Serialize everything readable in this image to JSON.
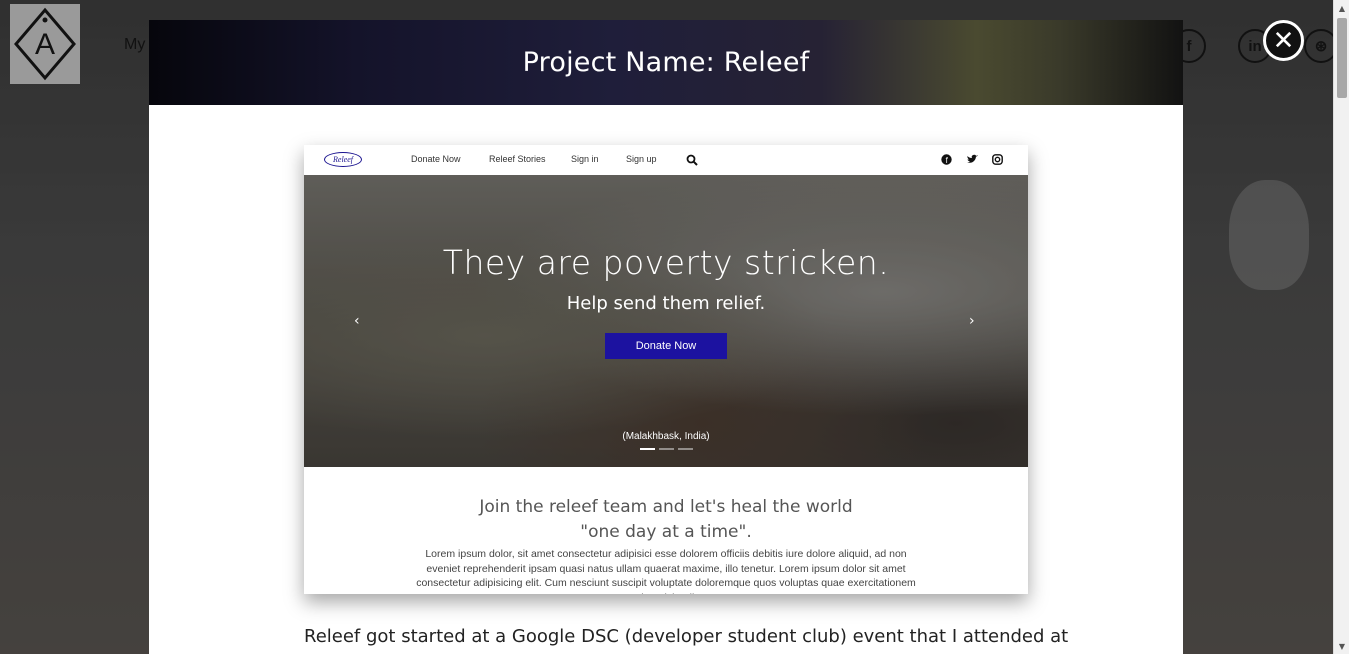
{
  "background": {
    "nav_text": "My",
    "social_icons": [
      "facebook-icon",
      "linkedin-icon",
      "dribbble-icon"
    ],
    "social_glyphs": [
      "f",
      "in",
      "⊛"
    ]
  },
  "modal": {
    "title": "Project Name: Releef",
    "close_glyph": "✕",
    "description": "Releef got started at a Google DSC (developer student club) event that I attended at"
  },
  "screenshot": {
    "logo": "Releef",
    "nav_links": [
      "Donate Now",
      "Releef Stories",
      "Sign in",
      "Sign up"
    ],
    "hero": {
      "headline": "They are poverty stricken.",
      "subheadline": "Help send them relief.",
      "button": "Donate Now",
      "caption": "(Malakhbask, India)",
      "prev": "‹",
      "next": "›",
      "indicator_count": 3,
      "active_indicator": 0
    },
    "body": {
      "heading_line1": "Join the releef team and let's heal the world",
      "heading_line2": "\"one day at a time\".",
      "lorem": "Lorem ipsum dolor, sit amet consectetur adipisici esse dolorem officiis debitis iure dolore aliquid, ad non eveniet reprehenderit ipsam quasi natus ullam quaerat maxime, illo tenetur. Lorem ipsum dolor sit amet consectetur adipisicing elit. Cum nesciunt suscipit voluptate doloremque quos voluptas quae exercitationem enim reiciendis!"
    }
  },
  "colors": {
    "accent": "#1c12a0",
    "modal_header": "#1f1e3a"
  }
}
